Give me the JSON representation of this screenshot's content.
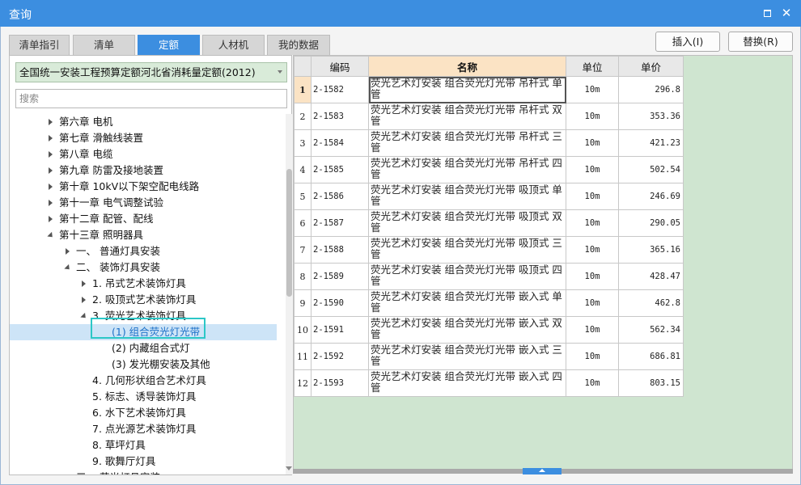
{
  "window": {
    "title": "查询",
    "close_glyph": "✕"
  },
  "tabs": [
    {
      "label": "清单指引"
    },
    {
      "label": "清单"
    },
    {
      "label": "定额"
    },
    {
      "label": "人材机"
    },
    {
      "label": "我的数据"
    }
  ],
  "actions": {
    "insert_label": "插入(I)",
    "replace_label": "替换(R)"
  },
  "left": {
    "quota_library": "全国统一安装工程预算定额河北省消耗量定额(2012)",
    "search_placeholder": "搜索",
    "tree": [
      {
        "label": "第六章 电机",
        "state": "closed",
        "level": 0
      },
      {
        "label": "第七章 滑触线装置",
        "state": "closed",
        "level": 0
      },
      {
        "label": "第八章 电缆",
        "state": "closed",
        "level": 0
      },
      {
        "label": "第九章 防雷及接地装置",
        "state": "closed",
        "level": 0
      },
      {
        "label": "第十章 10kV以下架空配电线路",
        "state": "closed",
        "level": 0
      },
      {
        "label": "第十一章 电气调整试验",
        "state": "closed",
        "level": 0
      },
      {
        "label": "第十二章 配管、配线",
        "state": "closed",
        "level": 0
      },
      {
        "label": "第十三章 照明器具",
        "state": "open",
        "level": 0
      },
      {
        "label": "一、 普通灯具安装",
        "state": "closed",
        "level": 1
      },
      {
        "label": "二、 装饰灯具安装",
        "state": "open",
        "level": 1
      },
      {
        "label": "1. 吊式艺术装饰灯具",
        "state": "closed",
        "level": 2
      },
      {
        "label": "2. 吸顶式艺术装饰灯具",
        "state": "closed",
        "level": 2
      },
      {
        "label": "3. 荧光艺术装饰灯具",
        "state": "open",
        "level": 2
      },
      {
        "label": "(1) 组合荧光灯光带",
        "state": "leaf",
        "level": 3,
        "selected": true
      },
      {
        "label": "(2) 内藏组合式灯",
        "state": "leaf",
        "level": 3
      },
      {
        "label": "(3) 发光棚安装及其他",
        "state": "leaf",
        "level": 3
      },
      {
        "label": "4. 几何形状组合艺术灯具",
        "state": "leaf",
        "level": 2
      },
      {
        "label": "5. 标志、诱导装饰灯具",
        "state": "leaf",
        "level": 2
      },
      {
        "label": "6. 水下艺术装饰灯具",
        "state": "leaf",
        "level": 2
      },
      {
        "label": "7. 点光源艺术装饰灯具",
        "state": "leaf",
        "level": 2
      },
      {
        "label": "8. 草坪灯具",
        "state": "leaf",
        "level": 2
      },
      {
        "label": "9. 歌舞厅灯具",
        "state": "leaf",
        "level": 2
      },
      {
        "label": "三、 荧光灯具安装",
        "state": "closed",
        "level": 1
      }
    ]
  },
  "grid": {
    "headers": {
      "code": "编码",
      "name": "名称",
      "unit": "单位",
      "price": "单价"
    },
    "rows": [
      {
        "no": "1",
        "code": "2-1582",
        "name": "荧光艺术灯安装 组合荧光灯光带 吊杆式 单管",
        "unit": "10m",
        "price": "296.8"
      },
      {
        "no": "2",
        "code": "2-1583",
        "name": "荧光艺术灯安装 组合荧光灯光带 吊杆式 双管",
        "unit": "10m",
        "price": "353.36"
      },
      {
        "no": "3",
        "code": "2-1584",
        "name": "荧光艺术灯安装 组合荧光灯光带 吊杆式 三管",
        "unit": "10m",
        "price": "421.23"
      },
      {
        "no": "4",
        "code": "2-1585",
        "name": "荧光艺术灯安装 组合荧光灯光带 吊杆式 四管",
        "unit": "10m",
        "price": "502.54"
      },
      {
        "no": "5",
        "code": "2-1586",
        "name": "荧光艺术灯安装 组合荧光灯光带 吸顶式 单管",
        "unit": "10m",
        "price": "246.69"
      },
      {
        "no": "6",
        "code": "2-1587",
        "name": "荧光艺术灯安装 组合荧光灯光带 吸顶式 双管",
        "unit": "10m",
        "price": "290.05"
      },
      {
        "no": "7",
        "code": "2-1588",
        "name": "荧光艺术灯安装 组合荧光灯光带 吸顶式 三管",
        "unit": "10m",
        "price": "365.16"
      },
      {
        "no": "8",
        "code": "2-1589",
        "name": "荧光艺术灯安装 组合荧光灯光带 吸顶式 四管",
        "unit": "10m",
        "price": "428.47"
      },
      {
        "no": "9",
        "code": "2-1590",
        "name": "荧光艺术灯安装 组合荧光灯光带 嵌入式 单管",
        "unit": "10m",
        "price": "462.8"
      },
      {
        "no": "10",
        "code": "2-1591",
        "name": "荧光艺术灯安装 组合荧光灯光带 嵌入式 双管",
        "unit": "10m",
        "price": "562.34"
      },
      {
        "no": "11",
        "code": "2-1592",
        "name": "荧光艺术灯安装 组合荧光灯光带 嵌入式 三管",
        "unit": "10m",
        "price": "686.81"
      },
      {
        "no": "12",
        "code": "2-1593",
        "name": "荧光艺术灯安装 组合荧光灯光带 嵌入式 四管",
        "unit": "10m",
        "price": "803.15"
      }
    ]
  }
}
